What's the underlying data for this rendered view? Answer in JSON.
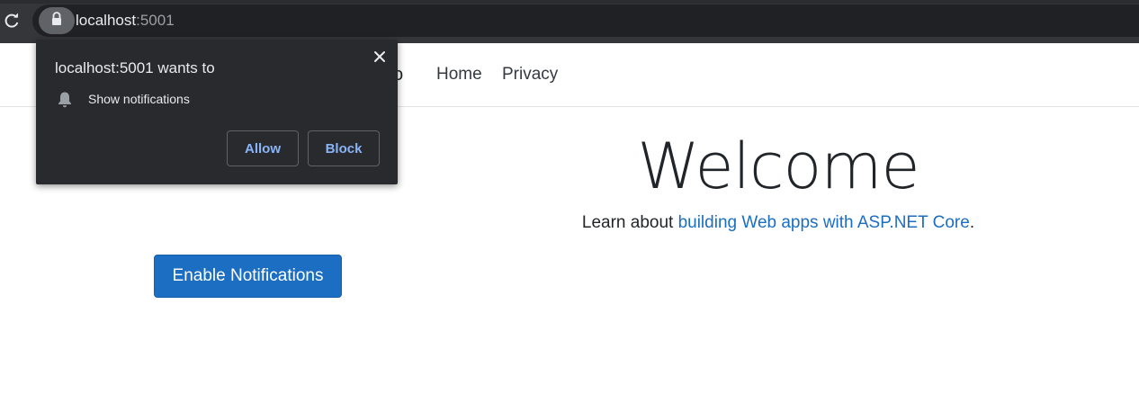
{
  "browser": {
    "url_host": "localhost",
    "url_port": ":5001"
  },
  "nav": {
    "brand_fragment": "o",
    "links": [
      {
        "label": "Home"
      },
      {
        "label": "Privacy"
      }
    ]
  },
  "main": {
    "heading": "Welcome",
    "learn_prefix": "Learn about ",
    "learn_link": "building Web apps with ASP.NET Core",
    "learn_suffix": ".",
    "enable_button": "Enable Notifications"
  },
  "permission_prompt": {
    "title": "localhost:5001 wants to",
    "item": "Show notifications",
    "allow": "Allow",
    "block": "Block"
  },
  "icons": {
    "reload": "reload-icon",
    "lock": "lock-icon",
    "close": "close-icon",
    "bell": "bell-icon"
  },
  "colors": {
    "primary": "#1b6ec2",
    "popup_bg": "#292a2d",
    "popup_button_text": "#8ab4f8",
    "browser_bar": "#35363a"
  }
}
